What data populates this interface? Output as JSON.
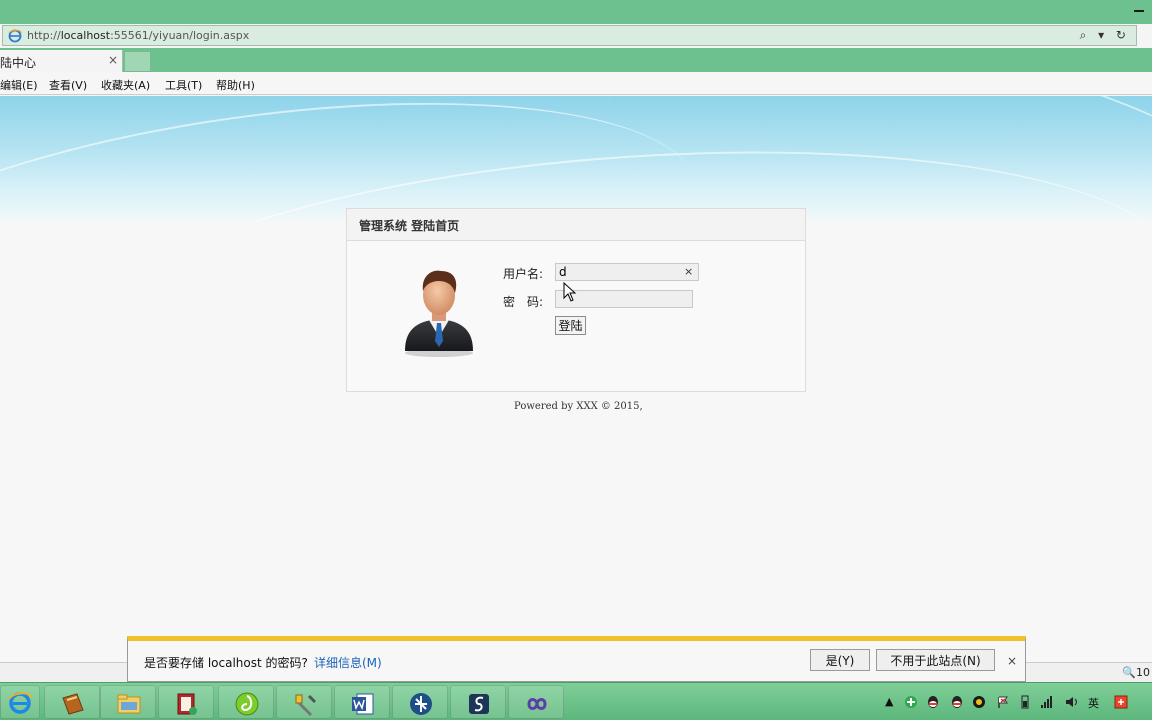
{
  "browser": {
    "url_prefix": "http://",
    "url_host": "localhost",
    "url_rest": ":55561/yiyuan/login.aspx",
    "addr_tools": "⌕ ▾ ↻",
    "tab_title": "陆中心",
    "tab_close": "×",
    "menu": [
      "编辑(E)",
      "查看(V)",
      "收藏夹(A)",
      "工具(T)",
      "帮助(H)"
    ]
  },
  "login": {
    "title": "管理系统 登陆首页",
    "username_label": "用户名:",
    "username_value": "d",
    "clear_icon": "×",
    "password_label": "密　码:",
    "password_value": "",
    "submit_label": "登陆",
    "footer": "Powered by XXX © 2015,"
  },
  "notification": {
    "message": "是否要存储 localhost 的密码?",
    "details_link": "详细信息(M)",
    "yes_label": "是(Y)",
    "never_label": "不用于此站点(N)",
    "close": "×"
  },
  "statusbar": {
    "zoom": "🔍10"
  },
  "tray": {
    "ime": "英"
  },
  "colors": {
    "chrome": "#6cc18e",
    "notify_accent": "#f0c12b",
    "link": "#1a63b8"
  }
}
